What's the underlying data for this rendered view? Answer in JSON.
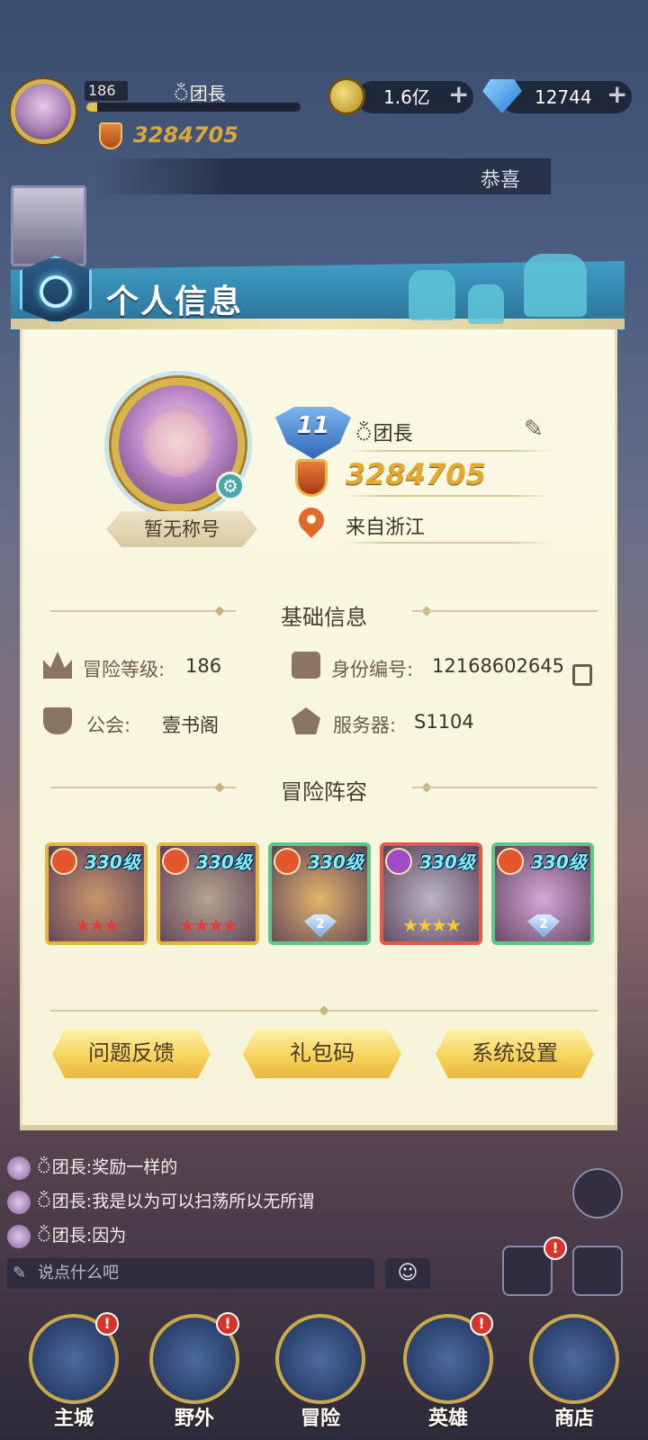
{
  "hud": {
    "level": "186",
    "name": "ঁ团長",
    "power": "3284705",
    "gold": "1.6亿",
    "gems": "12744",
    "exp_fraction": 0.05
  },
  "notice": {
    "text": "恭喜"
  },
  "panel": {
    "title": "个人信息",
    "title_plate": "暂无称号",
    "rank": "11",
    "player_name": "ঁ团長",
    "power": "3284705",
    "location": "来自浙江"
  },
  "basic_info": {
    "section_title": "基础信息",
    "adventure_level_label": "冒险等级:",
    "adventure_level": "186",
    "id_label": "身份编号:",
    "id": "12168602645",
    "guild_label": "公会:",
    "guild": "壹书阁",
    "server_label": "服务器:",
    "server": "S1104"
  },
  "lineup": {
    "section_title": "冒险阵容",
    "heroes": [
      {
        "level": "330级",
        "stars": "★★★",
        "element_color": "#e4572e",
        "frame": "#e5b53d",
        "art": "#c9956a"
      },
      {
        "level": "330级",
        "stars": "★★★★",
        "element_color": "#e4572e",
        "frame": "#e5b53d",
        "art": "#b7a38e"
      },
      {
        "level": "330级",
        "star_badge": "2",
        "element_color": "#e4572e",
        "frame": "#5fc68a",
        "art": "#e2b56a"
      },
      {
        "level": "330级",
        "stars": "★★★★",
        "element_color": "#a04ac7",
        "frame": "#e05c4a",
        "art": "#b9b6c6"
      },
      {
        "level": "330级",
        "star_badge": "2",
        "element_color": "#e4572e",
        "frame": "#5fc68a",
        "art": "#d6a6d8"
      }
    ]
  },
  "buttons": {
    "feedback": "问题反馈",
    "gift_code": "礼包码",
    "settings": "系统设置"
  },
  "chat": {
    "lines": [
      "ঁ团長:奖励一样的",
      "ঁ团長:我是以为可以扫荡所以无所谓",
      "ঁ团長:因为"
    ],
    "placeholder": "说点什么吧"
  },
  "nav": {
    "items": [
      {
        "label": "主城",
        "alert": "!"
      },
      {
        "label": "野外",
        "alert": "!"
      },
      {
        "label": "冒险"
      },
      {
        "label": "英雄",
        "alert": "!"
      },
      {
        "label": "商店"
      }
    ]
  }
}
